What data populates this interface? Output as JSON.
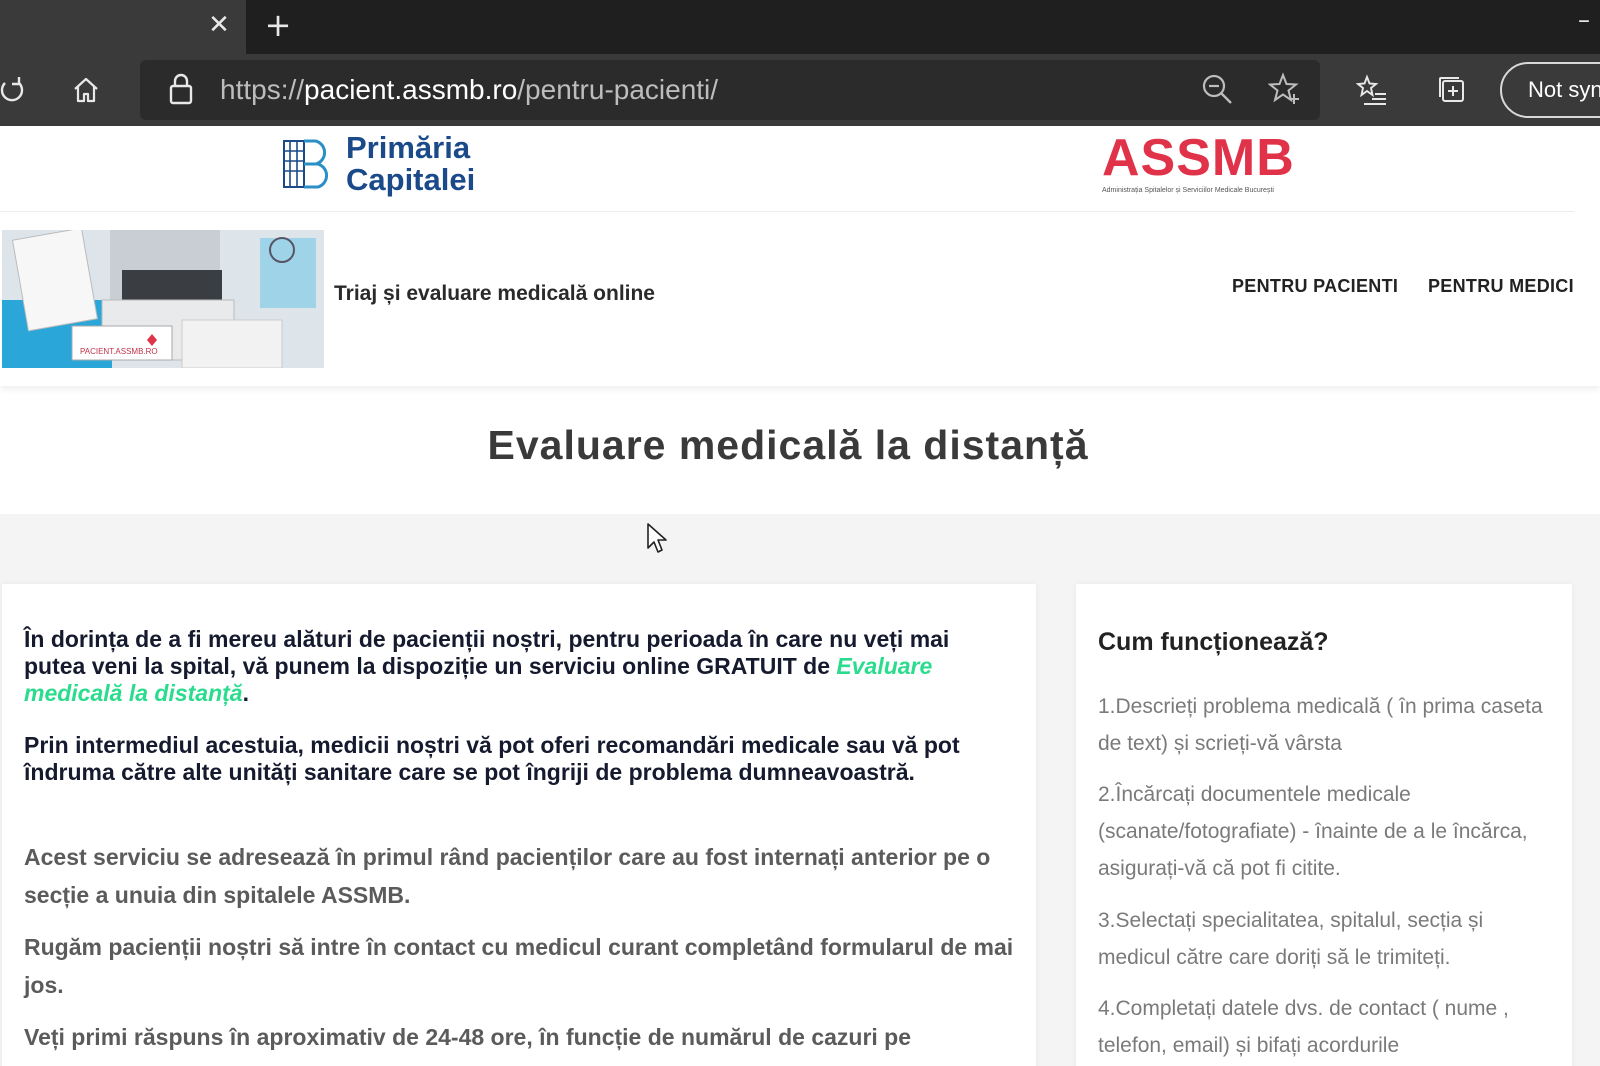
{
  "browser": {
    "address": {
      "scheme": "https://",
      "host": "pacient.assmb.ro",
      "path": "/pentru-pacienti/"
    },
    "sync_label": "Not syn"
  },
  "header": {
    "logo_left_line1": "Primăria",
    "logo_left_line2": "Capitalei",
    "logo_right_word": "ASSMB",
    "logo_right_sub": "Administrația Spitalelor și Serviciilor Medicale București"
  },
  "nav": {
    "tagline": "Triaj și evaluare medicală online",
    "links": [
      "PENTRU PACIENTI",
      "PENTRU MEDICI"
    ],
    "hero_caption": "PACIENT.ASSMB.RO"
  },
  "main": {
    "title": "Evaluare medicală la distanță",
    "intro_before": "În dorința de a fi mereu alături de pacienții noștri, pentru perioada în care nu veți mai putea veni la spital, vă punem la dispoziție un serviciu online GRATUIT de",
    "intro_link": "Evaluare medicală la distanță",
    "intro_after": ".",
    "paragraph2": "Prin intermediul acestuia, medicii noștri vă pot oferi recomandări medicale sau vă pot îndruma către alte unități sanitare care se pot îngriji de problema dumneavoastră.",
    "paragraph3": "Acest serviciu se adresează în primul rând pacienților care au fost internați anterior pe o secție a unuia din spitalele ASSMB.",
    "paragraph4": "Rugăm pacienții noștri să intre în contact cu medicul curant completând formularul de mai jos.",
    "paragraph5": "Veți primi răspuns în aproximativ de 24-48 ore, în funcție de numărul de cazuri pe"
  },
  "sidebar": {
    "title": "Cum funcționează?",
    "steps": [
      "1.Descrieți problema medicală ( în prima caseta de text) și scrieți-vă vârsta",
      "2.Încărcați documentele medicale (scanate/fotografiate) - înainte de a le încărca, asigurați-vă că pot fi citite.",
      "3.Selectați specialitatea, spitalul, secția și medicul către care doriți să le trimiteți.",
      "4.Completați datele dvs. de contact ( nume , telefon, email) și bifați acordurile"
    ]
  },
  "colors": {
    "brand_blue": "#1a4a8a",
    "brand_red": "#e0334a",
    "link_green": "#2bdc8e"
  }
}
